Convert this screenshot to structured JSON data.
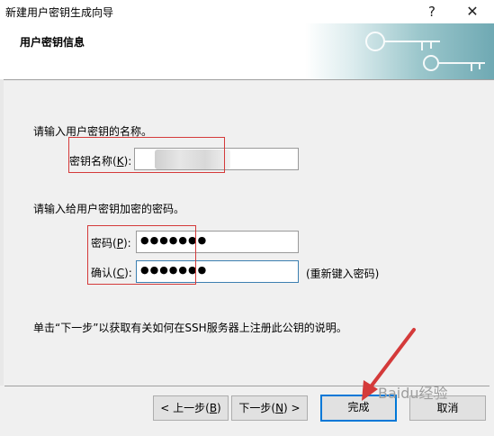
{
  "window": {
    "title": "新建用户密钥生成向导",
    "help_glyph": "?",
    "close_glyph": "✕"
  },
  "header": {
    "title": "用户密钥信息",
    "banner_icon": "key-icon"
  },
  "name_section": {
    "instruction": "请输入用户密钥的名称。",
    "label_prefix": "密钥名称(",
    "label_key": "K",
    "label_suffix": "):",
    "value": ""
  },
  "password_section": {
    "instruction": "请输入给用户密钥加密的密码。",
    "password_label_prefix": "密码(",
    "password_label_key": "P",
    "password_label_suffix": "):",
    "password_masked": "●●●●●●●",
    "confirm_label_prefix": "确认(",
    "confirm_label_key": "C",
    "confirm_label_suffix": "):",
    "confirm_masked": "●●●●●●●",
    "retype_hint": "(重新键入密码)"
  },
  "footer_note": "单击“下一步”以获取有关如何在SSH服务器上注册此公钥的说明。",
  "buttons": {
    "back_prefix": "< 上一步(",
    "back_key": "B",
    "back_suffix": ")",
    "next_prefix": "下一步(",
    "next_key": "N",
    "next_suffix": ") >",
    "finish": "完成",
    "cancel": "取消"
  },
  "watermark": "Baidu经验",
  "colors": {
    "annotation_red": "#d43a3a",
    "focus_blue": "#3c7fb1",
    "default_button_border": "#0078d7"
  }
}
